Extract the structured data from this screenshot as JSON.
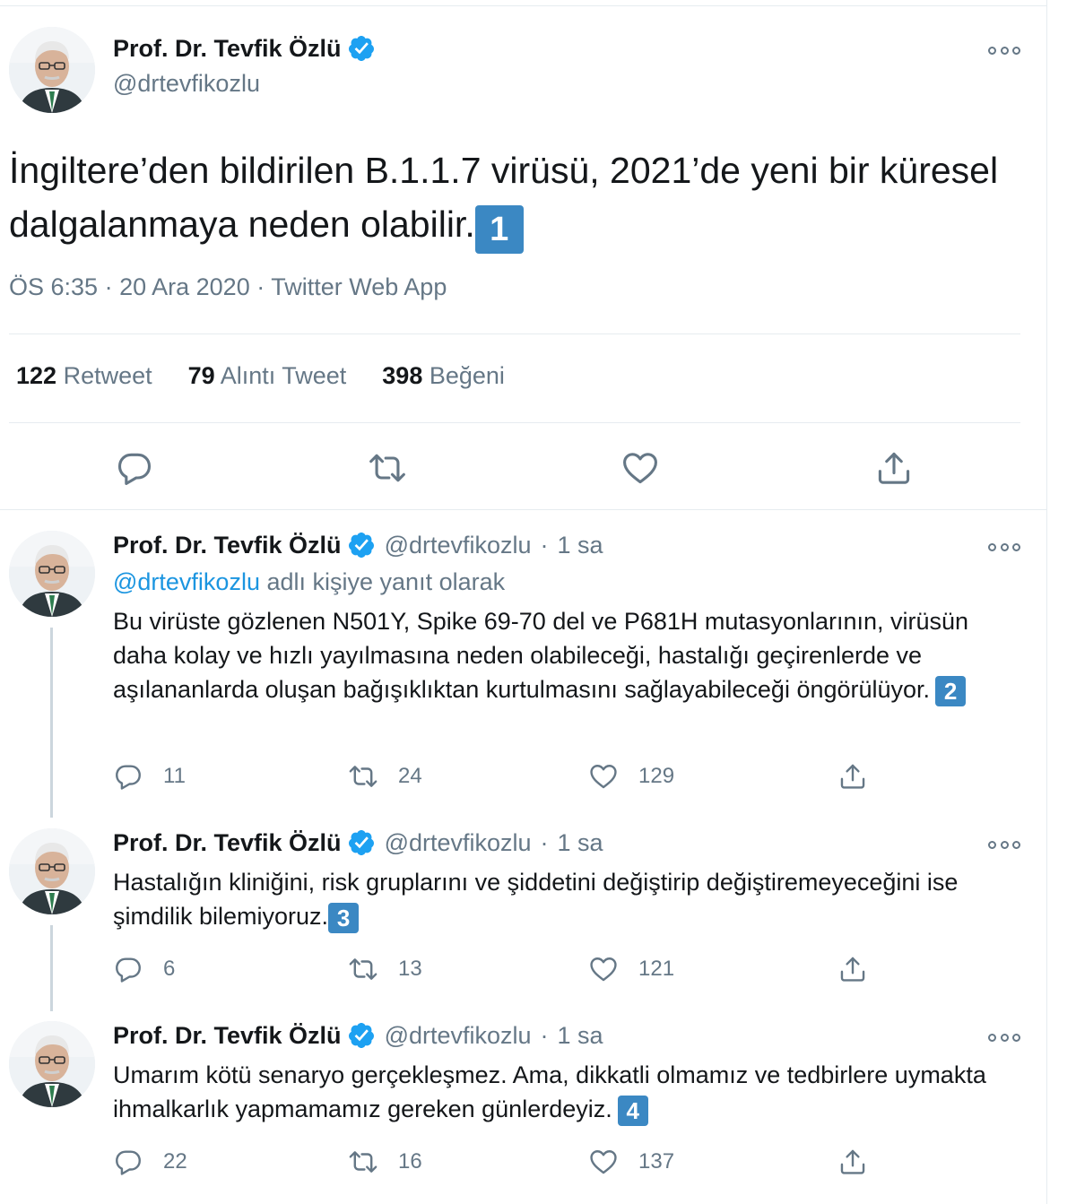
{
  "main_tweet": {
    "author_name": "Prof. Dr. Tevfik Özlü",
    "handle": "@drtevfikozlu",
    "text": "İngiltere’den bildirilen B.1.1.7 virüsü, 2021’de yeni bir küresel dalgalanmaya neden olabilir.",
    "badge": "1",
    "time": "ÖS 6:35",
    "date": "20 Ara 2020",
    "source": "Twitter Web App",
    "stats": {
      "retweets": "122",
      "retweets_label": "Retweet",
      "quotes": "79",
      "quotes_label": "Alıntı Tweet",
      "likes": "398",
      "likes_label": "Beğeni"
    }
  },
  "replies": [
    {
      "author_name": "Prof. Dr. Tevfik Özlü",
      "handle": "@drtevfikozlu",
      "time": "1 sa",
      "replying_to_handle": "@drtevfikozlu",
      "replying_to_suffix": "adlı kişiye yanıt olarak",
      "text": "Bu virüste gözlenen N501Y, Spike 69-70 del ve P681H mutasyonlarının, virüsün daha kolay ve hızlı yayılmasına neden olabileceği, hastalığı geçirenlerde ve aşılananlarda oluşan bağışıklıktan kurtulmasını sağlayabileceği öngörülüyor.",
      "badge": "2",
      "replies_count": "11",
      "retweets_count": "24",
      "likes_count": "129"
    },
    {
      "author_name": "Prof. Dr. Tevfik Özlü",
      "handle": "@drtevfikozlu",
      "time": "1 sa",
      "text": "Hastalığın kliniğini, risk gruplarını ve şiddetini değiştirip değiştiremeyeceğini ise şimdilik bilemiyoruz.",
      "badge": "3",
      "replies_count": "6",
      "retweets_count": "13",
      "likes_count": "121"
    },
    {
      "author_name": "Prof. Dr. Tevfik Özlü",
      "handle": "@drtevfikozlu",
      "time": "1 sa",
      "text": "Umarım kötü senaryo gerçekleşmez. Ama, dikkatli olmamız ve tedbirlere uymakta ihmalkarlık yapmamamız gereken günlerdeyiz.",
      "badge": "4",
      "replies_count": "22",
      "retweets_count": "16",
      "likes_count": "137"
    }
  ],
  "icons": {
    "verified": "verified-badge-icon",
    "more": "more-options-icon",
    "reply": "reply-icon",
    "retweet": "retweet-icon",
    "like": "heart-icon",
    "share": "share-icon"
  },
  "colors": {
    "verified_blue": "#1da1f2",
    "link_blue": "#1b95e0",
    "secondary_text": "#657786",
    "badge_blue": "#3b88c3"
  }
}
